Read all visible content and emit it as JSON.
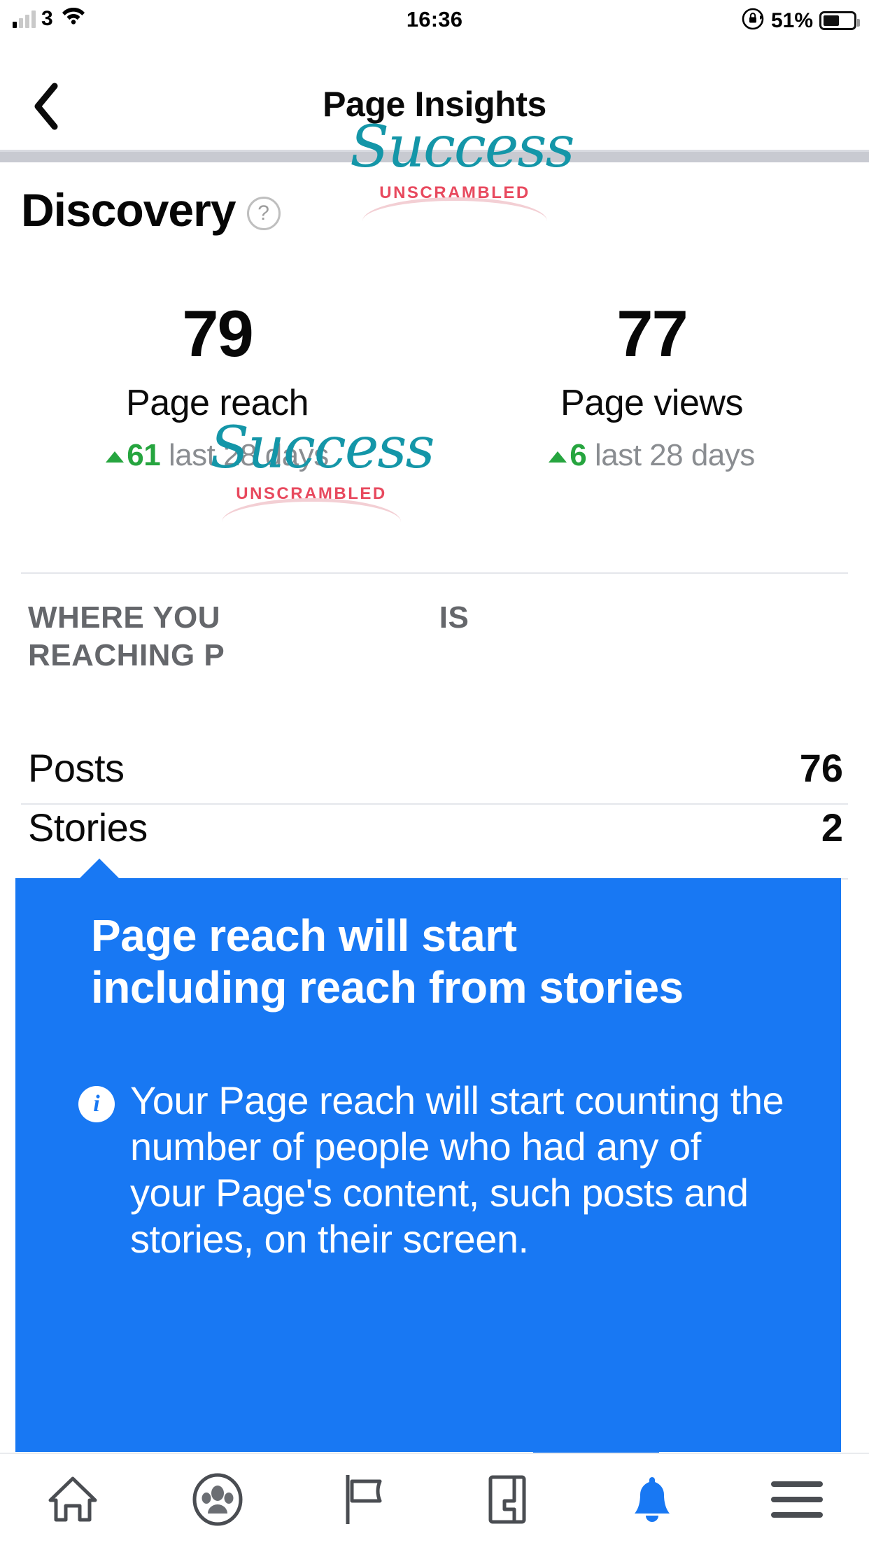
{
  "status_bar": {
    "carrier_label": "3",
    "time": "16:36",
    "battery_percent": "51%",
    "icons": [
      "signal-bars-icon",
      "wifi-icon",
      "rotation-lock-icon",
      "battery-icon"
    ]
  },
  "nav_header": {
    "back_icon": "chevron-left-icon",
    "title": "Page Insights"
  },
  "discovery": {
    "title": "Discovery",
    "help_icon_label": "?",
    "stats": [
      {
        "value": "79",
        "label": "Page reach",
        "delta_value": "61",
        "delta_period": "last 28 days",
        "delta_direction": "up"
      },
      {
        "value": "77",
        "label": "Page views",
        "delta_value": "6",
        "delta_period": "last 28 days",
        "delta_direction": "up"
      }
    ]
  },
  "reaching_section": {
    "heading_line1": "WHERE YOU",
    "heading_line1_end": "IS",
    "heading_line2": "REACHING P",
    "rows": [
      {
        "label": "Posts",
        "value": "76"
      },
      {
        "label": "Stories",
        "value": "2"
      }
    ]
  },
  "logo": {
    "script_text": "Success",
    "subtitle": "UNSCRAMBLED",
    "script_color": "#1496a8",
    "subtitle_color": "#e8495e"
  },
  "tooltip": {
    "title": "Page reach will start including reach from stories",
    "info_icon": "i",
    "body": "Your Page reach will start counting the number of people who had any of your Page's content, such posts and stories, on their screen.",
    "background_color": "#1878f3"
  },
  "bottom_nav": {
    "items": [
      {
        "name": "home",
        "icon": "home-icon",
        "active": false
      },
      {
        "name": "groups",
        "icon": "groups-icon",
        "active": false
      },
      {
        "name": "pages",
        "icon": "flag-icon",
        "active": false
      },
      {
        "name": "marketplace",
        "icon": "marketplace-icon",
        "active": false
      },
      {
        "name": "notifications",
        "icon": "bell-icon",
        "active": true
      },
      {
        "name": "menu",
        "icon": "hamburger-icon",
        "active": false
      }
    ],
    "active_color": "#1878f3",
    "inactive_color": "#4a4d52"
  }
}
